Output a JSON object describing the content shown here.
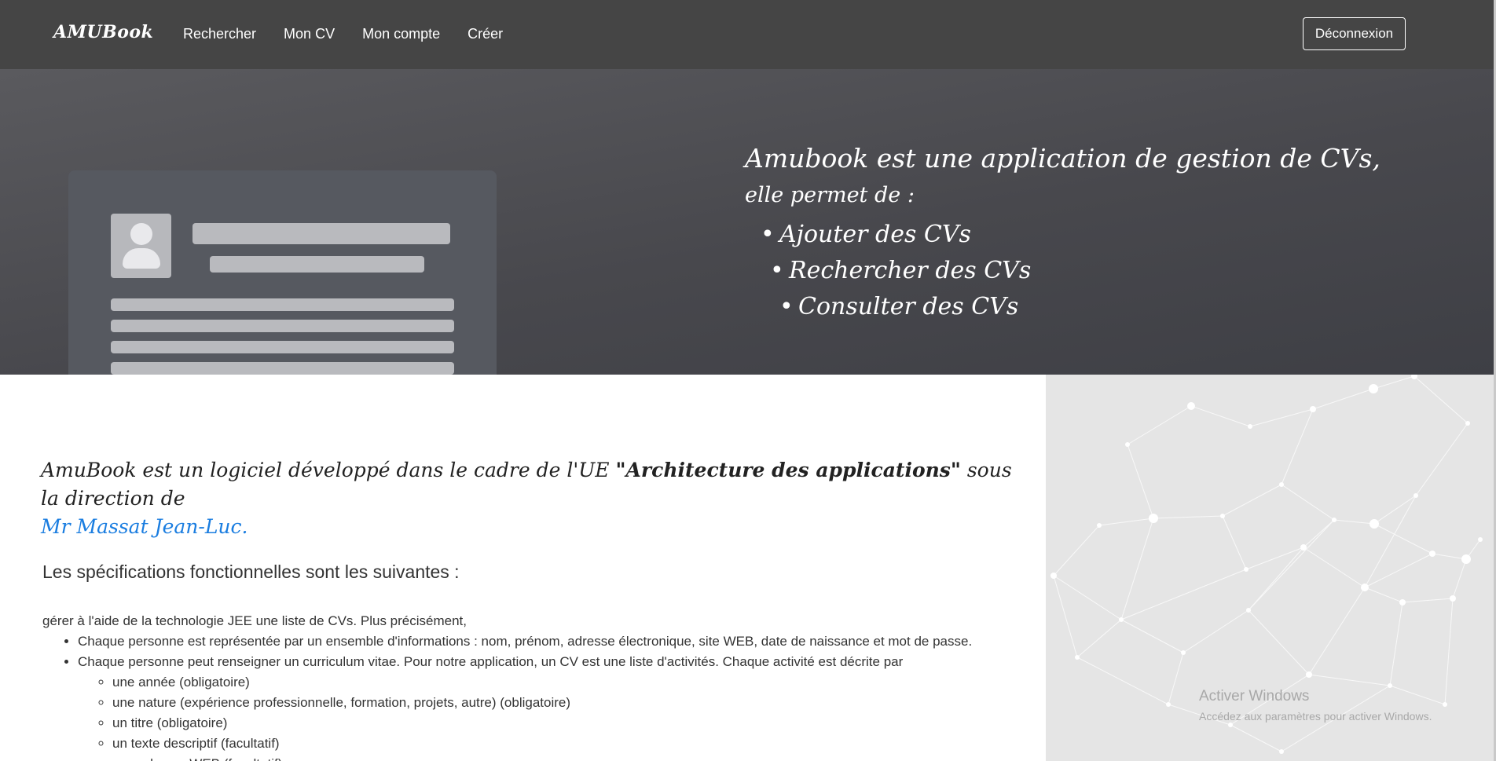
{
  "navbar": {
    "brand": "AMUBook",
    "links": [
      "Rechercher",
      "Mon CV",
      "Mon compte",
      "Créer"
    ],
    "logout_label": "Déconnexion"
  },
  "hero": {
    "title": "Amubook est une application de gestion de CVs,",
    "subtitle": "elle permet de :",
    "features": [
      "Ajouter des CVs",
      "Rechercher des CVs",
      "Consulter des CVs"
    ]
  },
  "intro": {
    "prefix": "AmuBook est un logiciel développé dans le cadre de l'UE ",
    "course": "\"Architecture des applications\"",
    "middle": " sous la direction de ",
    "teacher": "Mr Massat Jean-Luc."
  },
  "specs": {
    "heading": "Les spécifications fonctionnelles sont les suivantes :",
    "lead": "gérer à l'aide de la technologie JEE une liste de CVs. Plus précisément,",
    "items": [
      "Chaque personne est représentée par un ensemble d'informations : nom, prénom, adresse électronique, site WEB, date de naissance et mot de passe.",
      "Chaque personne peut renseigner un curriculum vitae. Pour notre application, un CV est une liste d'activités. Chaque activité est décrite par"
    ],
    "subitems": [
      "une année (obligatoire)",
      "une nature (expérience professionnelle, formation, projets, autre) (obligatoire)",
      "un titre (obligatoire)",
      "un texte descriptif (facultatif)",
      "une adresse WEB (facultatif)"
    ]
  },
  "watermark": {
    "title": "Activer Windows",
    "subtitle": "Accédez aux paramètres pour activer Windows."
  },
  "colors": {
    "navbar": "#454545",
    "link": "#1a7de0",
    "network_bg": "#e5e5e5"
  }
}
